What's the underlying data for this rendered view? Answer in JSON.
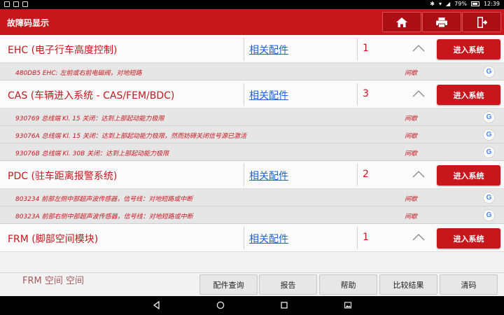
{
  "status_bar": {
    "battery": "79%",
    "time": "12:39"
  },
  "header": {
    "title": "故障码显示"
  },
  "parts_link_label": "相关配件",
  "enter_button_label": "进入系统",
  "groups": [
    {
      "name": "EHC (电子行车高度控制)",
      "count": "1",
      "faults": [
        {
          "code": "480DB5 EHC: 左前或右前电磁阀，对地短路",
          "status": "间歇"
        }
      ]
    },
    {
      "name": "CAS (车辆进入系统 - CAS/FEM/BDC)",
      "count": "3",
      "faults": [
        {
          "code": "930769 总线端 Kl. 15 关闭：达到上部起动能力极限",
          "status": "间歇"
        },
        {
          "code": "93076A 总线端 Kl. 15 关闭：达到上部起动能力极限，然而妨碍关闭信号源已激活",
          "status": "间歇"
        },
        {
          "code": "93076B 总线端 Kl. 30B 关闭：达到上部起动能力极限",
          "status": "间歇"
        }
      ]
    },
    {
      "name": "PDC (驻车距离报警系统)",
      "count": "2",
      "faults": [
        {
          "code": "803234 前部左侧中部超声波传感器，信号线：对地短路或中断",
          "status": "间歇"
        },
        {
          "code": "80323A 前部右侧中部超声波传感器，信号线：对地短路或中断",
          "status": "间歇"
        }
      ]
    },
    {
      "name": "FRM (脚部空间模块)",
      "count": "1",
      "faults": []
    }
  ],
  "footer": {
    "ghost_text": "FRM 空间 空间",
    "buttons": [
      "配件查询",
      "报告",
      "帮助",
      "比较结果",
      "清码"
    ]
  }
}
